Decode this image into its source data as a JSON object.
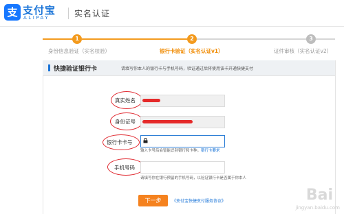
{
  "header": {
    "logo_cn": "支付宝",
    "logo_en": "ALIPAY",
    "title": "实名认证"
  },
  "steps": [
    {
      "num": "1",
      "label": "身份信息验证（实名校验）",
      "state": "done"
    },
    {
      "num": "2",
      "label": "银行卡验证（实名认证v1）",
      "state": "active"
    },
    {
      "num": "3",
      "label": "证件审核（实名认证v2）",
      "state": "todo"
    }
  ],
  "card": {
    "title": "快捷验证银行卡",
    "desc": "请填写你本人的银行卡与手机号码，验证通过后将使用该卡开通快捷支付"
  },
  "form": {
    "name_label": "真实姓名",
    "id_label": "身份证号",
    "card_label": "银行卡卡号",
    "card_hint": "输入卡号后会智能识别银行和卡种，",
    "card_hint_link": "银行卡要求",
    "phone_label": "手机号码",
    "phone_hint": "请填写你在银行预留的手机号码，以验证银行卡是否属于你本人"
  },
  "actions": {
    "next": "下一步",
    "agreement": "《支付宝快捷支付服务协议》"
  },
  "watermark": {
    "brand": "Bai",
    "url": "jingyan.baidu.com"
  },
  "colors": {
    "accent_blue": "#1b75d8",
    "step_orange": "#f39a1d",
    "button_orange": "#f5821f",
    "annotation_red": "#e0282f"
  }
}
